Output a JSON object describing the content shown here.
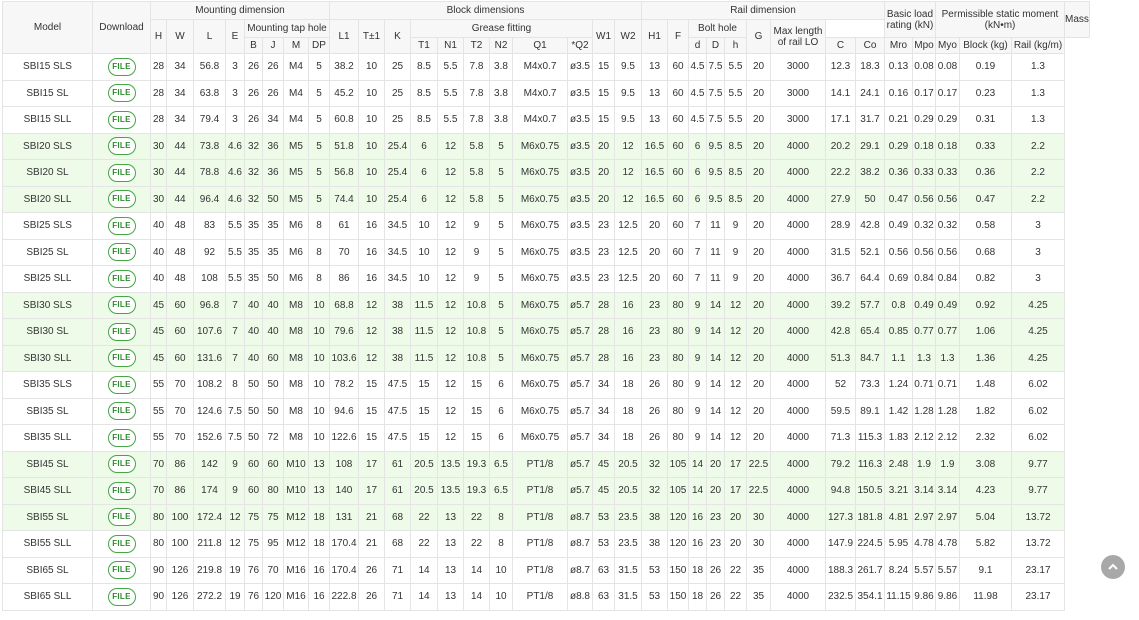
{
  "table": {
    "groups": {
      "model": "Model",
      "download": "Download",
      "mounting": "Mounting dimension",
      "block": "Block dimensions",
      "rail": "Rail dimension",
      "load": "Basic load rating (kN)",
      "moment": "Permissible static moment (kN•m)",
      "mass": "Mass"
    },
    "subgroups": {
      "tap": "Mounting tap hole",
      "grease": "Grease fitting",
      "bolt": "Bolt hole",
      "maxlen": "Max length of rail LO"
    },
    "cols": {
      "H": "H",
      "W": "W",
      "L": "L",
      "E": "E",
      "B": "B",
      "J": "J",
      "M": "M",
      "DP": "DP",
      "L1": "L1",
      "T": "T±1",
      "K": "K",
      "T1": "T1",
      "N1": "N1",
      "T2": "T2",
      "N2": "N2",
      "Q1": "Q1",
      "Q2": "*Q2",
      "W1": "W1",
      "W2": "W2",
      "H1": "H1",
      "F": "F",
      "d": "d",
      "D": "D",
      "h": "h",
      "G": "G",
      "C": "C",
      "Co": "Co",
      "Mro": "Mro",
      "Mpo": "Mpo",
      "Myo": "Myo",
      "block": "Block (kg)",
      "rail": "Rail (kg/m)"
    },
    "file_label": "FILE",
    "rows": [
      {
        "model": "SBI15 SLS",
        "H": "28",
        "W": "34",
        "L": "56.8",
        "E": "3",
        "B": "26",
        "J": "26",
        "M": "M4",
        "DP": "5",
        "L1": "38.2",
        "T": "10",
        "K": "25",
        "T1": "8.5",
        "N1": "5.5",
        "T2": "7.8",
        "N2": "3.8",
        "Q1": "M4x0.7",
        "Q2": "ø3.5",
        "W1": "15",
        "W2": "9.5",
        "H1": "13",
        "F": "60",
        "d": "4.5",
        "D": "7.5",
        "h": "5.5",
        "G": "20",
        "LO": "3000",
        "C": "12.3",
        "Co": "18.3",
        "Mro": "0.13",
        "Mpo": "0.08",
        "Myo": "0.08",
        "block": "0.19",
        "rail": "1.3"
      },
      {
        "model": "SBI15 SL",
        "H": "28",
        "W": "34",
        "L": "63.8",
        "E": "3",
        "B": "26",
        "J": "26",
        "M": "M4",
        "DP": "5",
        "L1": "45.2",
        "T": "10",
        "K": "25",
        "T1": "8.5",
        "N1": "5.5",
        "T2": "7.8",
        "N2": "3.8",
        "Q1": "M4x0.7",
        "Q2": "ø3.5",
        "W1": "15",
        "W2": "9.5",
        "H1": "13",
        "F": "60",
        "d": "4.5",
        "D": "7.5",
        "h": "5.5",
        "G": "20",
        "LO": "3000",
        "C": "14.1",
        "Co": "24.1",
        "Mro": "0.16",
        "Mpo": "0.17",
        "Myo": "0.17",
        "block": "0.23",
        "rail": "1.3"
      },
      {
        "model": "SBI15 SLL",
        "H": "28",
        "W": "34",
        "L": "79.4",
        "E": "3",
        "B": "26",
        "J": "34",
        "M": "M4",
        "DP": "5",
        "L1": "60.8",
        "T": "10",
        "K": "25",
        "T1": "8.5",
        "N1": "5.5",
        "T2": "7.8",
        "N2": "3.8",
        "Q1": "M4x0.7",
        "Q2": "ø3.5",
        "W1": "15",
        "W2": "9.5",
        "H1": "13",
        "F": "60",
        "d": "4.5",
        "D": "7.5",
        "h": "5.5",
        "G": "20",
        "LO": "3000",
        "C": "17.1",
        "Co": "31.7",
        "Mro": "0.21",
        "Mpo": "0.29",
        "Myo": "0.29",
        "block": "0.31",
        "rail": "1.3"
      },
      {
        "model": "SBI20 SLS",
        "H": "30",
        "W": "44",
        "L": "73.8",
        "E": "4.6",
        "B": "32",
        "J": "36",
        "M": "M5",
        "DP": "5",
        "L1": "51.8",
        "T": "10",
        "K": "25.4",
        "T1": "6",
        "N1": "12",
        "T2": "5.8",
        "N2": "5",
        "Q1": "M6x0.75",
        "Q2": "ø3.5",
        "W1": "20",
        "W2": "12",
        "H1": "16.5",
        "F": "60",
        "d": "6",
        "D": "9.5",
        "h": "8.5",
        "G": "20",
        "LO": "4000",
        "C": "20.2",
        "Co": "29.1",
        "Mro": "0.29",
        "Mpo": "0.18",
        "Myo": "0.18",
        "block": "0.33",
        "rail": "2.2"
      },
      {
        "model": "SBI20 SL",
        "H": "30",
        "W": "44",
        "L": "78.8",
        "E": "4.6",
        "B": "32",
        "J": "36",
        "M": "M5",
        "DP": "5",
        "L1": "56.8",
        "T": "10",
        "K": "25.4",
        "T1": "6",
        "N1": "12",
        "T2": "5.8",
        "N2": "5",
        "Q1": "M6x0.75",
        "Q2": "ø3.5",
        "W1": "20",
        "W2": "12",
        "H1": "16.5",
        "F": "60",
        "d": "6",
        "D": "9.5",
        "h": "8.5",
        "G": "20",
        "LO": "4000",
        "C": "22.2",
        "Co": "38.2",
        "Mro": "0.36",
        "Mpo": "0.33",
        "Myo": "0.33",
        "block": "0.36",
        "rail": "2.2"
      },
      {
        "model": "SBI20 SLL",
        "H": "30",
        "W": "44",
        "L": "96.4",
        "E": "4.6",
        "B": "32",
        "J": "50",
        "M": "M5",
        "DP": "5",
        "L1": "74.4",
        "T": "10",
        "K": "25.4",
        "T1": "6",
        "N1": "12",
        "T2": "5.8",
        "N2": "5",
        "Q1": "M6x0.75",
        "Q2": "ø3.5",
        "W1": "20",
        "W2": "12",
        "H1": "16.5",
        "F": "60",
        "d": "6",
        "D": "9.5",
        "h": "8.5",
        "G": "20",
        "LO": "4000",
        "C": "27.9",
        "Co": "50",
        "Mro": "0.47",
        "Mpo": "0.56",
        "Myo": "0.56",
        "block": "0.47",
        "rail": "2.2"
      },
      {
        "model": "SBI25 SLS",
        "H": "40",
        "W": "48",
        "L": "83",
        "E": "5.5",
        "B": "35",
        "J": "35",
        "M": "M6",
        "DP": "8",
        "L1": "61",
        "T": "16",
        "K": "34.5",
        "T1": "10",
        "N1": "12",
        "T2": "9",
        "N2": "5",
        "Q1": "M6x0.75",
        "Q2": "ø3.5",
        "W1": "23",
        "W2": "12.5",
        "H1": "20",
        "F": "60",
        "d": "7",
        "D": "11",
        "h": "9",
        "G": "20",
        "LO": "4000",
        "C": "28.9",
        "Co": "42.8",
        "Mro": "0.49",
        "Mpo": "0.32",
        "Myo": "0.32",
        "block": "0.58",
        "rail": "3"
      },
      {
        "model": "SBI25 SL",
        "H": "40",
        "W": "48",
        "L": "92",
        "E": "5.5",
        "B": "35",
        "J": "35",
        "M": "M6",
        "DP": "8",
        "L1": "70",
        "T": "16",
        "K": "34.5",
        "T1": "10",
        "N1": "12",
        "T2": "9",
        "N2": "5",
        "Q1": "M6x0.75",
        "Q2": "ø3.5",
        "W1": "23",
        "W2": "12.5",
        "H1": "20",
        "F": "60",
        "d": "7",
        "D": "11",
        "h": "9",
        "G": "20",
        "LO": "4000",
        "C": "31.5",
        "Co": "52.1",
        "Mro": "0.56",
        "Mpo": "0.56",
        "Myo": "0.56",
        "block": "0.68",
        "rail": "3"
      },
      {
        "model": "SBI25 SLL",
        "H": "40",
        "W": "48",
        "L": "108",
        "E": "5.5",
        "B": "35",
        "J": "50",
        "M": "M6",
        "DP": "8",
        "L1": "86",
        "T": "16",
        "K": "34.5",
        "T1": "10",
        "N1": "12",
        "T2": "9",
        "N2": "5",
        "Q1": "M6x0.75",
        "Q2": "ø3.5",
        "W1": "23",
        "W2": "12.5",
        "H1": "20",
        "F": "60",
        "d": "7",
        "D": "11",
        "h": "9",
        "G": "20",
        "LO": "4000",
        "C": "36.7",
        "Co": "64.4",
        "Mro": "0.69",
        "Mpo": "0.84",
        "Myo": "0.84",
        "block": "0.82",
        "rail": "3"
      },
      {
        "model": "SBI30 SLS",
        "H": "45",
        "W": "60",
        "L": "96.8",
        "E": "7",
        "B": "40",
        "J": "40",
        "M": "M8",
        "DP": "10",
        "L1": "68.8",
        "T": "12",
        "K": "38",
        "T1": "11.5",
        "N1": "12",
        "T2": "10.8",
        "N2": "5",
        "Q1": "M6x0.75",
        "Q2": "ø5.7",
        "W1": "28",
        "W2": "16",
        "H1": "23",
        "F": "80",
        "d": "9",
        "D": "14",
        "h": "12",
        "G": "20",
        "LO": "4000",
        "C": "39.2",
        "Co": "57.7",
        "Mro": "0.8",
        "Mpo": "0.49",
        "Myo": "0.49",
        "block": "0.92",
        "rail": "4.25"
      },
      {
        "model": "SBI30 SL",
        "H": "45",
        "W": "60",
        "L": "107.6",
        "E": "7",
        "B": "40",
        "J": "40",
        "M": "M8",
        "DP": "10",
        "L1": "79.6",
        "T": "12",
        "K": "38",
        "T1": "11.5",
        "N1": "12",
        "T2": "10.8",
        "N2": "5",
        "Q1": "M6x0.75",
        "Q2": "ø5.7",
        "W1": "28",
        "W2": "16",
        "H1": "23",
        "F": "80",
        "d": "9",
        "D": "14",
        "h": "12",
        "G": "20",
        "LO": "4000",
        "C": "42.8",
        "Co": "65.4",
        "Mro": "0.85",
        "Mpo": "0.77",
        "Myo": "0.77",
        "block": "1.06",
        "rail": "4.25"
      },
      {
        "model": "SBI30 SLL",
        "H": "45",
        "W": "60",
        "L": "131.6",
        "E": "7",
        "B": "40",
        "J": "60",
        "M": "M8",
        "DP": "10",
        "L1": "103.6",
        "T": "12",
        "K": "38",
        "T1": "11.5",
        "N1": "12",
        "T2": "10.8",
        "N2": "5",
        "Q1": "M6x0.75",
        "Q2": "ø5.7",
        "W1": "28",
        "W2": "16",
        "H1": "23",
        "F": "80",
        "d": "9",
        "D": "14",
        "h": "12",
        "G": "20",
        "LO": "4000",
        "C": "51.3",
        "Co": "84.7",
        "Mro": "1.1",
        "Mpo": "1.3",
        "Myo": "1.3",
        "block": "1.36",
        "rail": "4.25"
      },
      {
        "model": "SBI35 SLS",
        "H": "55",
        "W": "70",
        "L": "108.2",
        "E": "8",
        "B": "50",
        "J": "50",
        "M": "M8",
        "DP": "10",
        "L1": "78.2",
        "T": "15",
        "K": "47.5",
        "T1": "15",
        "N1": "12",
        "T2": "15",
        "N2": "6",
        "Q1": "M6x0.75",
        "Q2": "ø5.7",
        "W1": "34",
        "W2": "18",
        "H1": "26",
        "F": "80",
        "d": "9",
        "D": "14",
        "h": "12",
        "G": "20",
        "LO": "4000",
        "C": "52",
        "Co": "73.3",
        "Mro": "1.24",
        "Mpo": "0.71",
        "Myo": "0.71",
        "block": "1.48",
        "rail": "6.02"
      },
      {
        "model": "SBI35 SL",
        "H": "55",
        "W": "70",
        "L": "124.6",
        "E": "7.5",
        "B": "50",
        "J": "50",
        "M": "M8",
        "DP": "10",
        "L1": "94.6",
        "T": "15",
        "K": "47.5",
        "T1": "15",
        "N1": "12",
        "T2": "15",
        "N2": "6",
        "Q1": "M6x0.75",
        "Q2": "ø5.7",
        "W1": "34",
        "W2": "18",
        "H1": "26",
        "F": "80",
        "d": "9",
        "D": "14",
        "h": "12",
        "G": "20",
        "LO": "4000",
        "C": "59.5",
        "Co": "89.1",
        "Mro": "1.42",
        "Mpo": "1.28",
        "Myo": "1.28",
        "block": "1.82",
        "rail": "6.02"
      },
      {
        "model": "SBI35 SLL",
        "H": "55",
        "W": "70",
        "L": "152.6",
        "E": "7.5",
        "B": "50",
        "J": "72",
        "M": "M8",
        "DP": "10",
        "L1": "122.6",
        "T": "15",
        "K": "47.5",
        "T1": "15",
        "N1": "12",
        "T2": "15",
        "N2": "6",
        "Q1": "M6x0.75",
        "Q2": "ø5.7",
        "W1": "34",
        "W2": "18",
        "H1": "26",
        "F": "80",
        "d": "9",
        "D": "14",
        "h": "12",
        "G": "20",
        "LO": "4000",
        "C": "71.3",
        "Co": "115.3",
        "Mro": "1.83",
        "Mpo": "2.12",
        "Myo": "2.12",
        "block": "2.32",
        "rail": "6.02"
      },
      {
        "model": "SBI45 SL",
        "H": "70",
        "W": "86",
        "L": "142",
        "E": "9",
        "B": "60",
        "J": "60",
        "M": "M10",
        "DP": "13",
        "L1": "108",
        "T": "17",
        "K": "61",
        "T1": "20.5",
        "N1": "13.5",
        "T2": "19.3",
        "N2": "6.5",
        "Q1": "PT1/8",
        "Q2": "ø5.7",
        "W1": "45",
        "W2": "20.5",
        "H1": "32",
        "F": "105",
        "d": "14",
        "D": "20",
        "h": "17",
        "G": "22.5",
        "LO": "4000",
        "C": "79.2",
        "Co": "116.3",
        "Mro": "2.48",
        "Mpo": "1.9",
        "Myo": "1.9",
        "block": "3.08",
        "rail": "9.77"
      },
      {
        "model": "SBI45 SLL",
        "H": "70",
        "W": "86",
        "L": "174",
        "E": "9",
        "B": "60",
        "J": "80",
        "M": "M10",
        "DP": "13",
        "L1": "140",
        "T": "17",
        "K": "61",
        "T1": "20.5",
        "N1": "13.5",
        "T2": "19.3",
        "N2": "6.5",
        "Q1": "PT1/8",
        "Q2": "ø5.7",
        "W1": "45",
        "W2": "20.5",
        "H1": "32",
        "F": "105",
        "d": "14",
        "D": "20",
        "h": "17",
        "G": "22.5",
        "LO": "4000",
        "C": "94.8",
        "Co": "150.5",
        "Mro": "3.21",
        "Mpo": "3.14",
        "Myo": "3.14",
        "block": "4.23",
        "rail": "9.77"
      },
      {
        "model": "SBI55 SL",
        "H": "80",
        "W": "100",
        "L": "172.4",
        "E": "12",
        "B": "75",
        "J": "75",
        "M": "M12",
        "DP": "18",
        "L1": "131",
        "T": "21",
        "K": "68",
        "T1": "22",
        "N1": "13",
        "T2": "22",
        "N2": "8",
        "Q1": "PT1/8",
        "Q2": "ø8.7",
        "W1": "53",
        "W2": "23.5",
        "H1": "38",
        "F": "120",
        "d": "16",
        "D": "23",
        "h": "20",
        "G": "30",
        "LO": "4000",
        "C": "127.3",
        "Co": "181.8",
        "Mro": "4.81",
        "Mpo": "2.97",
        "Myo": "2.97",
        "block": "5.04",
        "rail": "13.72"
      },
      {
        "model": "SBI55 SLL",
        "H": "80",
        "W": "100",
        "L": "211.8",
        "E": "12",
        "B": "75",
        "J": "95",
        "M": "M12",
        "DP": "18",
        "L1": "170.4",
        "T": "21",
        "K": "68",
        "T1": "22",
        "N1": "13",
        "T2": "22",
        "N2": "8",
        "Q1": "PT1/8",
        "Q2": "ø8.7",
        "W1": "53",
        "W2": "23.5",
        "H1": "38",
        "F": "120",
        "d": "16",
        "D": "23",
        "h": "20",
        "G": "30",
        "LO": "4000",
        "C": "147.9",
        "Co": "224.5",
        "Mro": "5.95",
        "Mpo": "4.78",
        "Myo": "4.78",
        "block": "5.82",
        "rail": "13.72"
      },
      {
        "model": "SBI65 SL",
        "H": "90",
        "W": "126",
        "L": "219.8",
        "E": "19",
        "B": "76",
        "J": "70",
        "M": "M16",
        "DP": "16",
        "L1": "170.4",
        "T": "26",
        "K": "71",
        "T1": "14",
        "N1": "13",
        "T2": "14",
        "N2": "10",
        "Q1": "PT1/8",
        "Q2": "ø8.7",
        "W1": "63",
        "W2": "31.5",
        "H1": "53",
        "F": "150",
        "d": "18",
        "D": "26",
        "h": "22",
        "G": "35",
        "LO": "4000",
        "C": "188.3",
        "Co": "261.7",
        "Mro": "8.24",
        "Mpo": "5.57",
        "Myo": "5.57",
        "block": "9.1",
        "rail": "23.17"
      },
      {
        "model": "SBI65 SLL",
        "H": "90",
        "W": "126",
        "L": "272.2",
        "E": "19",
        "B": "76",
        "J": "120",
        "M": "M16",
        "DP": "16",
        "L1": "222.8",
        "T": "26",
        "K": "71",
        "T1": "14",
        "N1": "13",
        "T2": "14",
        "N2": "10",
        "Q1": "PT1/8",
        "Q2": "ø8.8",
        "W1": "63",
        "W2": "31.5",
        "H1": "53",
        "F": "150",
        "d": "18",
        "D": "26",
        "h": "22",
        "G": "35",
        "LO": "4000",
        "C": "232.5",
        "Co": "354.1",
        "Mro": "11.15",
        "Mpo": "9.86",
        "Myo": "9.86",
        "block": "11.98",
        "rail": "23.17"
      }
    ]
  },
  "scroll_top": {
    "icon": "chevron-up-icon"
  }
}
